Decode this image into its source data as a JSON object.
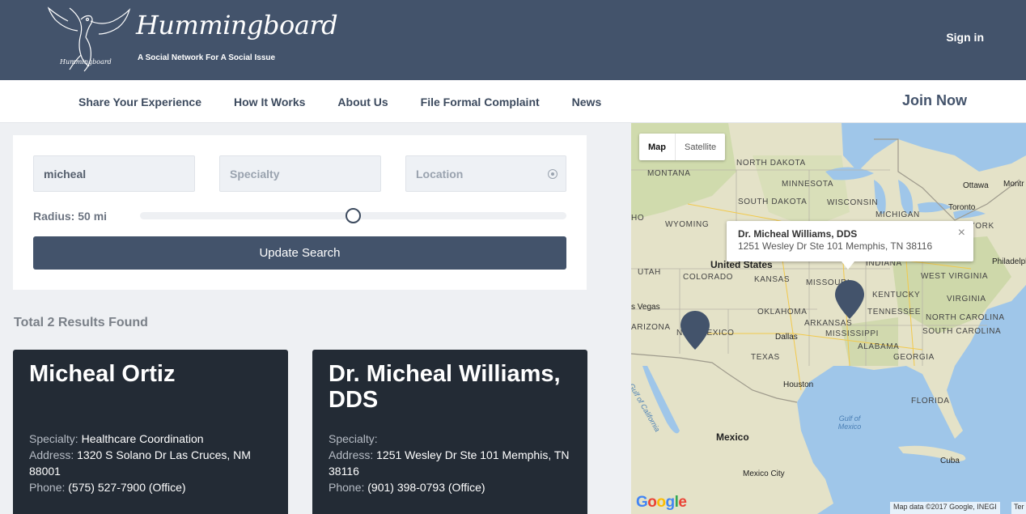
{
  "header": {
    "logo_title": "Hummingboard",
    "logo_small": "Hummingboard",
    "tagline": "A Social Network For A Social Issue",
    "signin": "Sign in"
  },
  "nav": {
    "items": [
      "Share Your Experience",
      "How It Works",
      "About Us",
      "File Formal Complaint",
      "News"
    ],
    "join": "Join Now"
  },
  "search": {
    "name_value": "micheal",
    "specialty_placeholder": "Specialty",
    "location_placeholder": "Location",
    "radius_label": "Radius: 50 mi",
    "radius_value": 0.5,
    "button": "Update Search"
  },
  "results": {
    "count_text": "Total 2 Results Found",
    "items": [
      {
        "name": "Micheal Ortiz",
        "specialty_label": "Specialty:",
        "specialty": "Healthcare Coordination",
        "address_label": "Address:",
        "address": "1320 S Solano Dr Las Cruces, NM 88001",
        "phone_label": "Phone:",
        "phone": "(575) 527-7900 (Office)"
      },
      {
        "name": "Dr. Micheal Williams, DDS",
        "specialty_label": "Specialty:",
        "specialty": "",
        "address_label": "Address:",
        "address": "1251 Wesley Dr Ste 101 Memphis, TN 38116",
        "phone_label": "Phone:",
        "phone": "(901) 398-0793 (Office)"
      }
    ]
  },
  "map": {
    "type_map": "Map",
    "type_satellite": "Satellite",
    "infowindow": {
      "title": "Dr. Micheal Williams, DDS",
      "address": "1251 Wesley Dr Ste 101 Memphis, TN 38116",
      "close": "×"
    },
    "labels": {
      "north_dakota": "NORTH DAKOTA",
      "montana": "MONTANA",
      "minnesota": "MINNESOTA",
      "south_dakota": "SOUTH DAKOTA",
      "wisconsin": "WISCONSIN",
      "michigan": "MICHIGAN",
      "wyoming": "WYOMING",
      "utah": "UTAH",
      "colorado": "COLORADO",
      "kansas": "KANSAS",
      "missouri": "MISSOURI",
      "indiana": "INDIANA",
      "oklahoma": "OKLAHOMA",
      "arkansas": "ARKANSAS",
      "tennessee": "TENNESSEE",
      "kentucky": "KENTUCKY",
      "west_virginia": "WEST VIRGINIA",
      "virginia": "VIRGINIA",
      "north_carolina": "NORTH CAROLINA",
      "south_carolina": "SOUTH CAROLINA",
      "mississippi": "MISSISSIPPI",
      "alabama": "ALABAMA",
      "georgia": "GEORGIA",
      "texas": "TEXAS",
      "new_mexico": "NEW MEXICO",
      "arizona": "ARIZONA",
      "florida": "FLORIDA",
      "york": "YORK",
      "united_states": "United States",
      "mexico": "Mexico",
      "cuba": "Cuba",
      "gulf_of_california": "Gulf of California",
      "gulf_of_mexico": "Gulf of Mexico",
      "ottawa": "Ottawa",
      "montreal": "Montr",
      "toronto": "Toronto",
      "philadelphia": "Philadelph",
      "las_vegas": "s Vegas",
      "dallas": "Dallas",
      "houston": "Houston",
      "mexico_city": "Mexico City",
      "ho": "HO"
    },
    "google": [
      "G",
      "o",
      "o",
      "g",
      "l",
      "e"
    ],
    "attribution": "Map data ©2017 Google, INEGI",
    "terms": "Ter"
  }
}
